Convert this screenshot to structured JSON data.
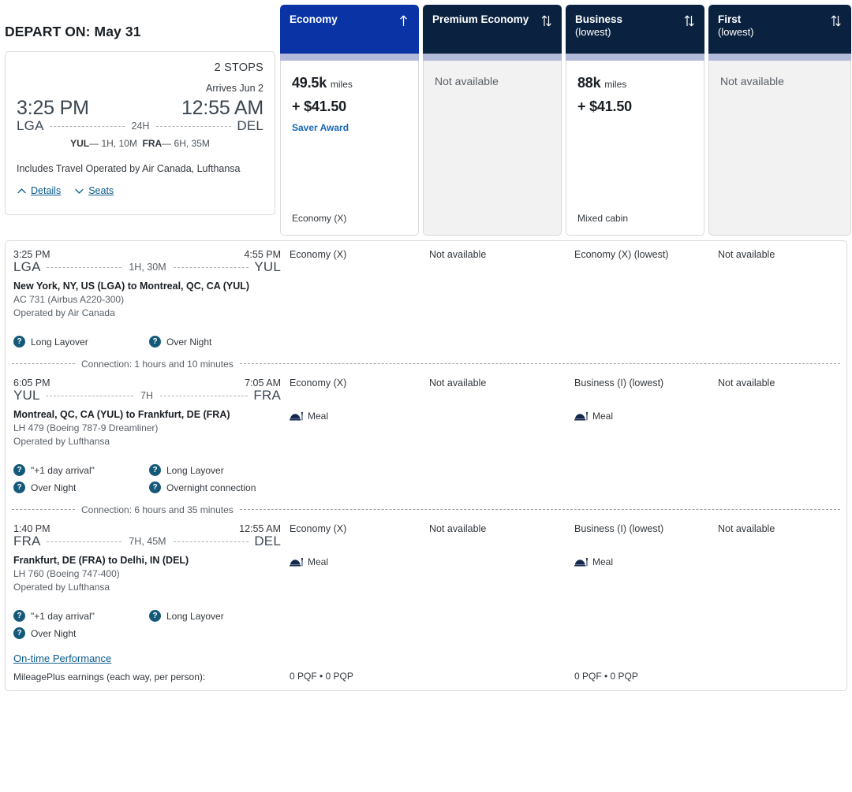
{
  "header": {
    "depart_label": "DEPART ON: May 31"
  },
  "summary": {
    "stops": "2 STOPS",
    "arrives": "Arrives Jun 2",
    "depart_time": "3:25 PM",
    "arrive_time": "12:55 AM",
    "origin_code": "LGA",
    "dest_code": "DEL",
    "total_duration": "24H",
    "layovers": [
      {
        "code": "YUL",
        "dash": "—",
        "duration": "1H, 10M"
      },
      {
        "code": "FRA",
        "dash": "—",
        "duration": "6H, 35M"
      }
    ],
    "includes": "Includes Travel Operated by Air Canada, Lufthansa",
    "details_link": "Details",
    "seats_link": "Seats"
  },
  "fare_columns": [
    {
      "title": "Economy",
      "sub": "",
      "selected": true,
      "available": true,
      "sort_icon": "sort-ascending-icon",
      "miles": "49.5k",
      "miles_unit": "miles",
      "cash": "+ $41.50",
      "award_label": "Saver Award",
      "foot": "Economy (X)",
      "unavailable_label": ""
    },
    {
      "title": "Premium Economy",
      "sub": "",
      "selected": false,
      "available": false,
      "sort_icon": "sort-both-icon",
      "miles": "",
      "miles_unit": "",
      "cash": "",
      "award_label": "",
      "foot": "",
      "unavailable_label": "Not available"
    },
    {
      "title": "Business",
      "sub": "(lowest)",
      "selected": false,
      "available": true,
      "sort_icon": "sort-both-icon",
      "miles": "88k",
      "miles_unit": "miles",
      "cash": "+ $41.50",
      "award_label": "",
      "foot": "Mixed cabin",
      "unavailable_label": ""
    },
    {
      "title": "First",
      "sub": "(lowest)",
      "selected": false,
      "available": false,
      "sort_icon": "sort-both-icon",
      "miles": "",
      "miles_unit": "",
      "cash": "",
      "award_label": "",
      "foot": "",
      "unavailable_label": "Not available"
    }
  ],
  "segments": [
    {
      "depart_time": "3:25 PM",
      "arrive_time": "4:55 PM",
      "origin_code": "LGA",
      "dest_code": "YUL",
      "duration": "1H, 30M",
      "route": "New York, NY, US (LGA) to Montreal, QC, CA (YUL)",
      "flight": "AC 731 (Airbus A220-300)",
      "operated": "Operated by Air Canada",
      "badges": [
        [
          "Long Layover",
          "Over Night"
        ]
      ],
      "cabins": [
        "Economy (X)",
        "Not available",
        "Economy (X) (lowest)",
        "Not available"
      ],
      "meals": [
        "",
        "",
        "",
        ""
      ],
      "connection": "Connection: 1 hours and 10 minutes"
    },
    {
      "depart_time": "6:05 PM",
      "arrive_time": "7:05 AM",
      "origin_code": "YUL",
      "dest_code": "FRA",
      "duration": "7H",
      "route": "Montreal, QC, CA (YUL) to Frankfurt, DE (FRA)",
      "flight": "LH 479 (Boeing 787-9 Dreamliner)",
      "operated": "Operated by Lufthansa",
      "badges": [
        [
          "\"+1 day arrival\"",
          "Long Layover"
        ],
        [
          "Over Night",
          "Overnight connection"
        ]
      ],
      "cabins": [
        "Economy (X)",
        "Not available",
        "Business (I) (lowest)",
        "Not available"
      ],
      "meals": [
        "Meal",
        "",
        "Meal",
        ""
      ],
      "connection": "Connection: 6 hours and 35 minutes"
    },
    {
      "depart_time": "1:40 PM",
      "arrive_time": "12:55 AM",
      "origin_code": "FRA",
      "dest_code": "DEL",
      "duration": "7H, 45M",
      "route": "Frankfurt, DE (FRA) to Delhi, IN (DEL)",
      "flight": "LH 760 (Boeing 747-400)",
      "operated": "Operated by Lufthansa",
      "badges": [
        [
          "\"+1 day arrival\"",
          "Long Layover"
        ],
        [
          "Over Night",
          ""
        ]
      ],
      "cabins": [
        "Economy (X)",
        "Not available",
        "Business (I) (lowest)",
        "Not available"
      ],
      "meals": [
        "Meal",
        "",
        "Meal",
        ""
      ],
      "connection": ""
    }
  ],
  "footer": {
    "on_time_link": "On-time Performance",
    "earnings_label": "MileagePlus earnings (each way, per person):",
    "earnings": [
      "0 PQF • 0 PQP",
      "",
      "0 PQF • 0 PQP",
      ""
    ]
  },
  "colors": {
    "header_navy": "#0a2240",
    "header_selected_blue": "#0a34a5",
    "band_lavender": "#b3bad9",
    "link_blue": "#0a5a8c",
    "saver_blue": "#1668b7",
    "badge_teal": "#15597a",
    "unavailable_bg": "#f2f2f2"
  }
}
